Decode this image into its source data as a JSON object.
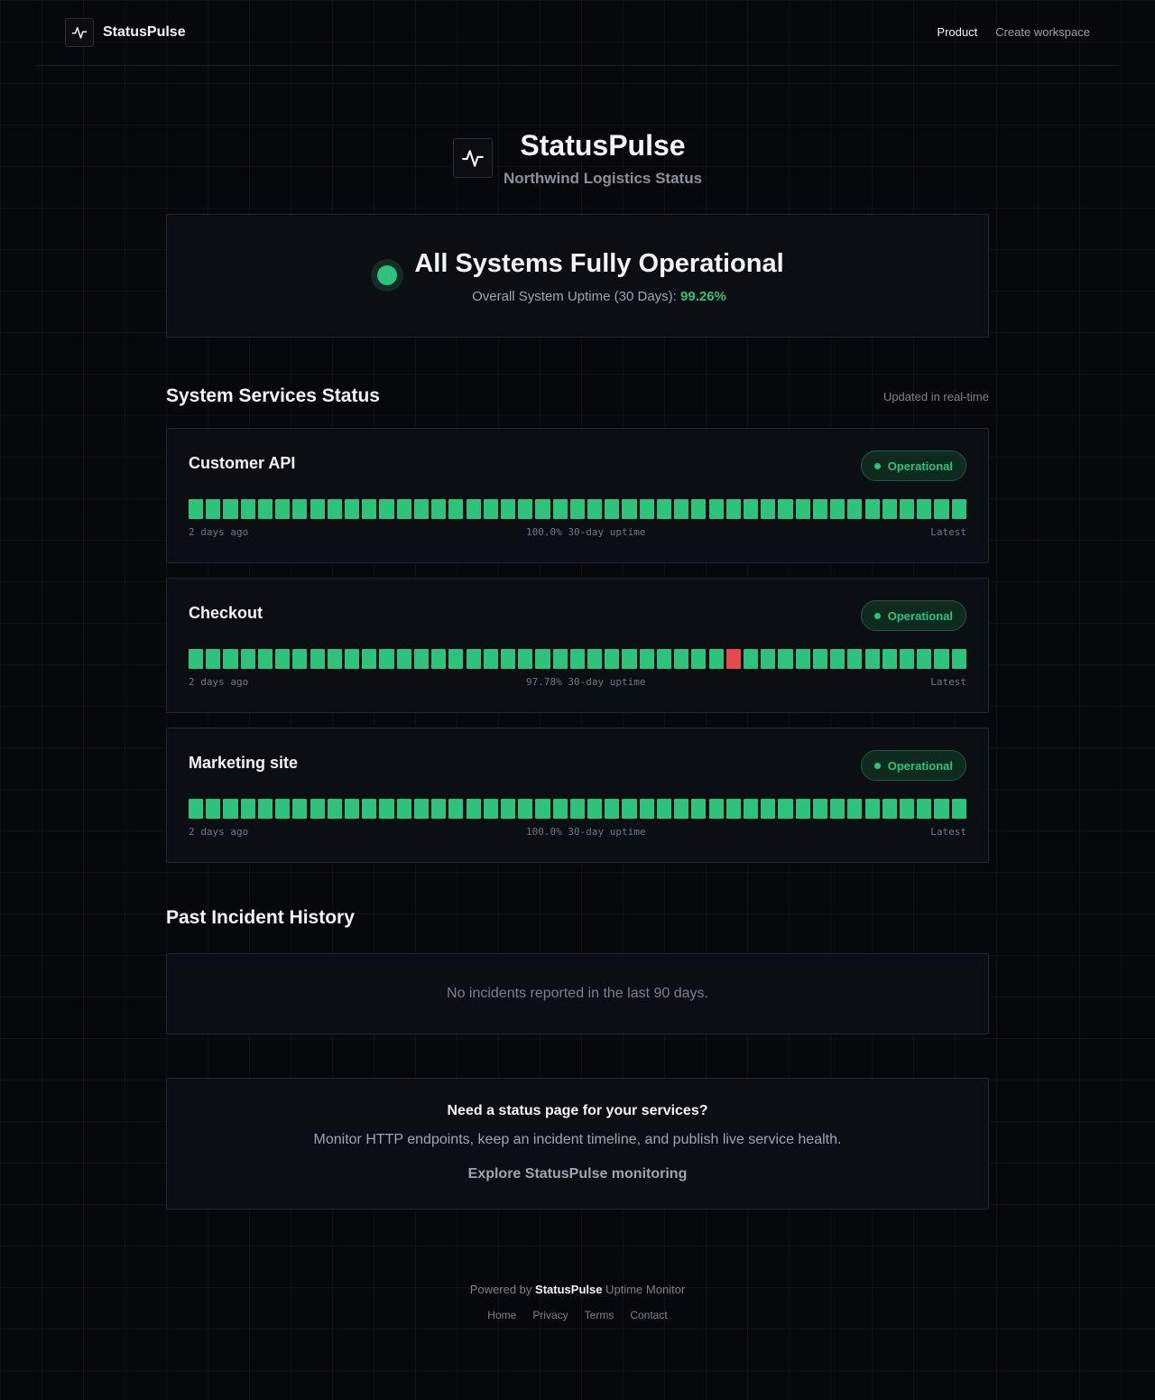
{
  "nav": {
    "brand": "StatusPulse",
    "logo_icon": "pulse-icon",
    "links": [
      {
        "label": "Product",
        "active": true
      },
      {
        "label": "Create workspace",
        "active": false
      }
    ]
  },
  "hero": {
    "title": "StatusPulse",
    "subtitle": "Northwind Logistics Status"
  },
  "overall": {
    "title": "All Systems Fully Operational",
    "uptime_label": "Overall System Uptime (30 Days):",
    "uptime_value": "99.26%",
    "status_color": "#2dc37d"
  },
  "services_section": {
    "title": "System Services Status",
    "note": "Updated in real-time"
  },
  "services": [
    {
      "name": "Customer API",
      "status": "Operational",
      "uptime_text": "100.0% 30-day uptime",
      "start_label": "2 days ago",
      "end_label": "Latest",
      "bars": [
        "up",
        "up",
        "up",
        "up",
        "up",
        "up",
        "up",
        "up",
        "up",
        "up",
        "up",
        "up",
        "up",
        "up",
        "up",
        "up",
        "up",
        "up",
        "up",
        "up",
        "up",
        "up",
        "up",
        "up",
        "up",
        "up",
        "up",
        "up",
        "up",
        "up",
        "up",
        "up",
        "up",
        "up",
        "up",
        "up",
        "up",
        "up",
        "up",
        "up",
        "up",
        "up",
        "up",
        "up",
        "up"
      ]
    },
    {
      "name": "Checkout",
      "status": "Operational",
      "uptime_text": "97.78% 30-day uptime",
      "start_label": "2 days ago",
      "end_label": "Latest",
      "bars": [
        "up",
        "up",
        "up",
        "up",
        "up",
        "up",
        "up",
        "up",
        "up",
        "up",
        "up",
        "up",
        "up",
        "up",
        "up",
        "up",
        "up",
        "up",
        "up",
        "up",
        "up",
        "up",
        "up",
        "up",
        "up",
        "up",
        "up",
        "up",
        "up",
        "up",
        "up",
        "down",
        "up",
        "up",
        "up",
        "up",
        "up",
        "up",
        "up",
        "up",
        "up",
        "up",
        "up",
        "up",
        "up"
      ]
    },
    {
      "name": "Marketing site",
      "status": "Operational",
      "uptime_text": "100.0% 30-day uptime",
      "start_label": "2 days ago",
      "end_label": "Latest",
      "bars": [
        "up",
        "up",
        "up",
        "up",
        "up",
        "up",
        "up",
        "up",
        "up",
        "up",
        "up",
        "up",
        "up",
        "up",
        "up",
        "up",
        "up",
        "up",
        "up",
        "up",
        "up",
        "up",
        "up",
        "up",
        "up",
        "up",
        "up",
        "up",
        "up",
        "up",
        "up",
        "up",
        "up",
        "up",
        "up",
        "up",
        "up",
        "up",
        "up",
        "up",
        "up",
        "up",
        "up",
        "up",
        "up"
      ]
    }
  ],
  "incidents": {
    "title": "Past Incident History",
    "empty_text": "No incidents reported in the last 90 days."
  },
  "cta": {
    "title": "Need a status page for your services?",
    "body": "Monitor HTTP endpoints, keep an incident timeline, and publish live service health.",
    "link": "Explore StatusPulse monitoring"
  },
  "footer": {
    "powered_prefix": "Powered by",
    "powered_brand": "StatusPulse",
    "powered_suffix": "Uptime Monitor",
    "links": [
      "Home",
      "Privacy",
      "Terms",
      "Contact"
    ]
  },
  "colors": {
    "up": "#2dc37d",
    "down": "#e5484d",
    "background": "#07080b"
  }
}
